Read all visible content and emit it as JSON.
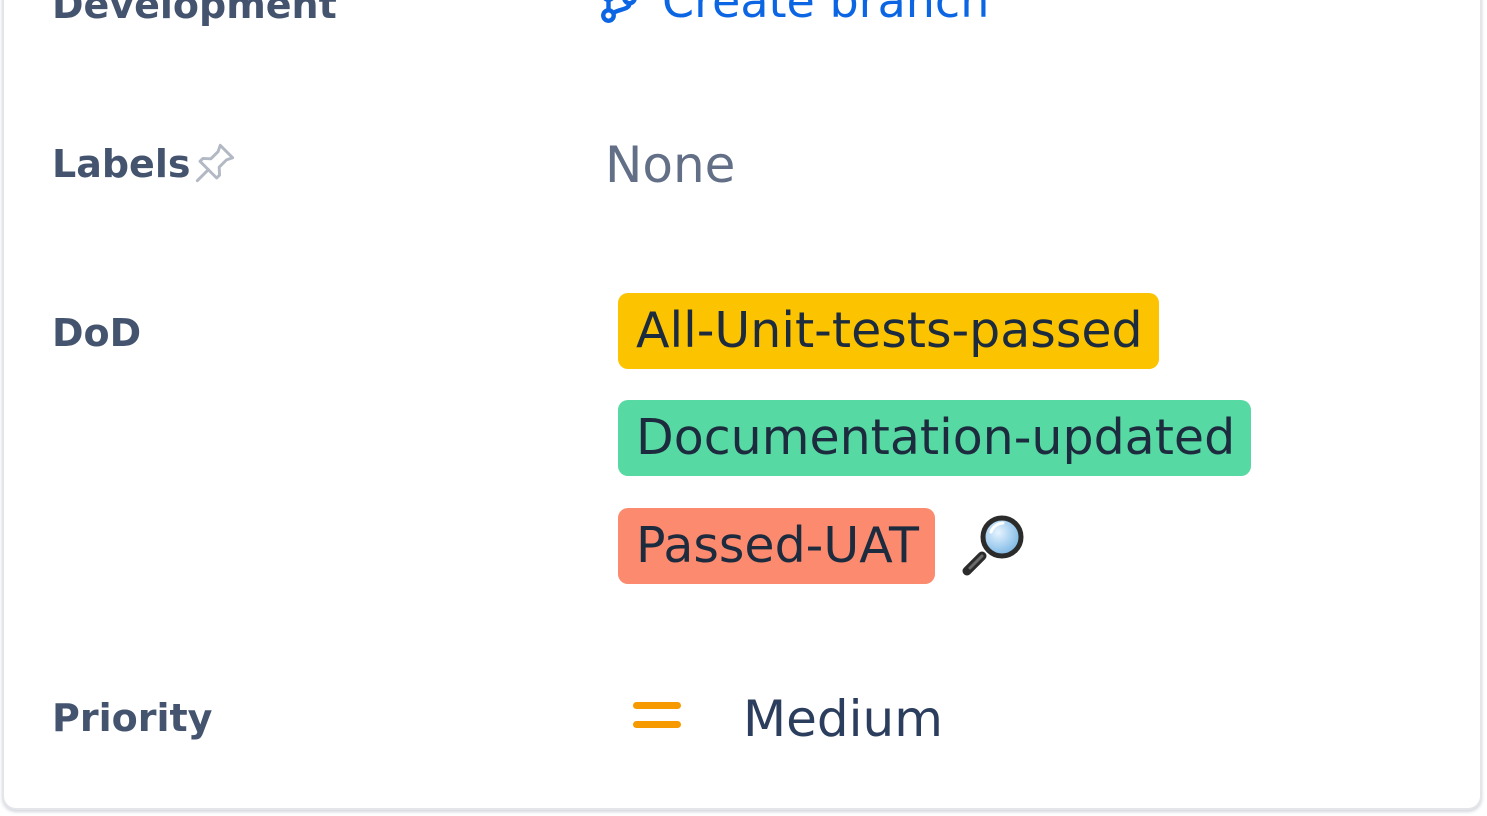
{
  "fields": {
    "development": {
      "label": "Development",
      "action_label": "Create branch",
      "action_icon": "branch-icon"
    },
    "labels": {
      "label": "Labels",
      "pin_icon": "pin-icon",
      "value": "None"
    },
    "dod": {
      "label": "DoD",
      "items": [
        {
          "text": "All-Unit-tests-passed",
          "color": "#fcc300"
        },
        {
          "text": "Documentation-updated",
          "color": "#57d9a3"
        },
        {
          "text": "Passed-UAT",
          "color": "#fb8a6e"
        }
      ],
      "search_icon": "magnifying-glass-icon"
    },
    "priority": {
      "label": "Priority",
      "icon": "priority-medium-icon",
      "icon_color": "#f79a00",
      "value": "Medium"
    }
  },
  "colors": {
    "label_text": "#44546f",
    "link": "#0c66e4",
    "muted_text": "#626f86"
  }
}
